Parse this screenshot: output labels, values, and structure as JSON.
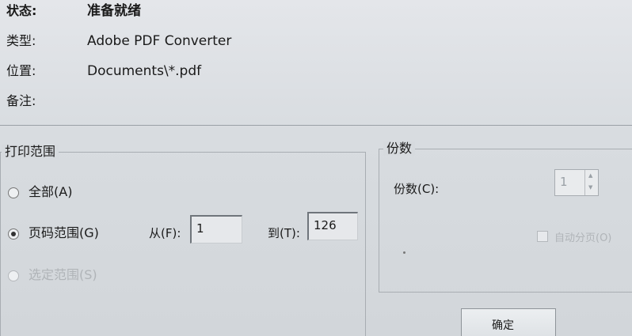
{
  "info": {
    "status_label": "状态:",
    "status_value": "准备就绪",
    "type_label": "类型:",
    "type_value": "Adobe PDF Converter",
    "location_label": "位置:",
    "location_value": "Documents\\*.pdf",
    "comment_label": "备注:"
  },
  "print_range": {
    "title": "打印范围",
    "all_label": "全部(A)",
    "pages_label": "页码范围(G)",
    "selection_label": "选定范围(S)",
    "from_label": "从(F):",
    "from_value": "1",
    "to_label": "到(T):",
    "to_value": "126"
  },
  "copies": {
    "title": "份数",
    "copies_label": "份数(C):",
    "copies_value": "1",
    "collate_label": "自动分页(O)"
  },
  "buttons": {
    "ok_label": "确定"
  }
}
